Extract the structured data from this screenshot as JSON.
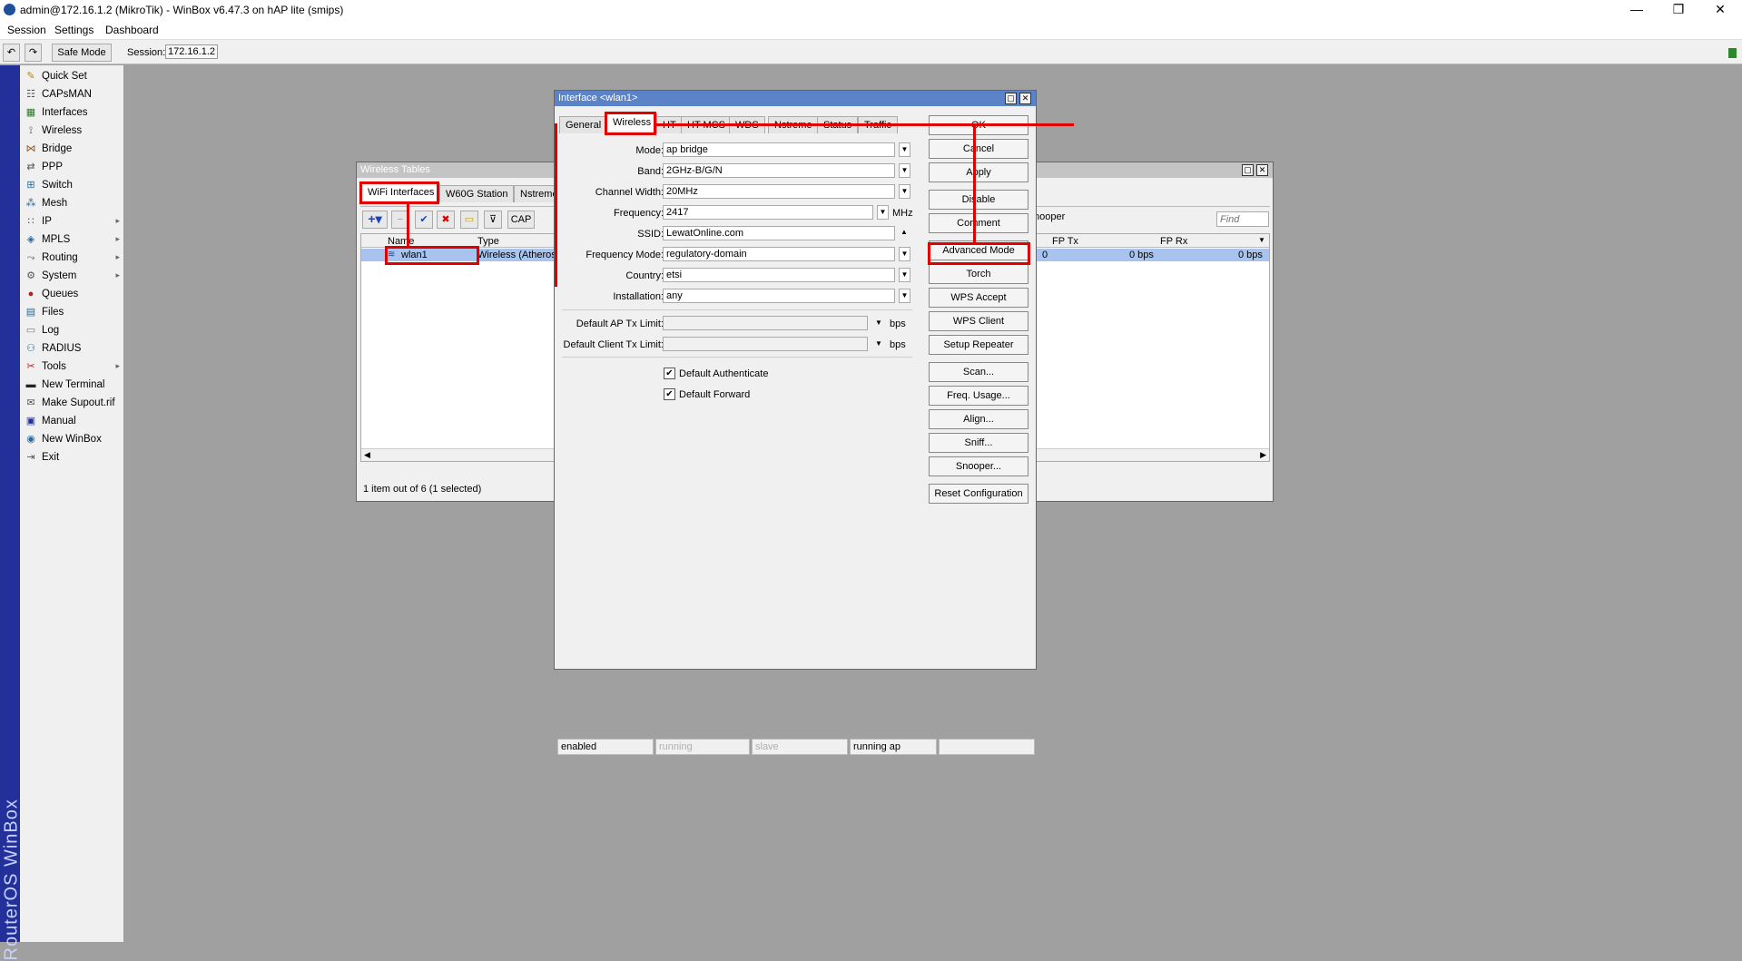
{
  "window": {
    "title": "admin@172.16.1.2 (MikroTik) - WinBox v6.47.3 on hAP lite (smips)",
    "minimize": "—",
    "restore": "❐",
    "close": "✕"
  },
  "menu": [
    "Session",
    "Settings",
    "Dashboard"
  ],
  "toolbar": {
    "undo": "↶",
    "redo": "↷",
    "safe_mode": "Safe Mode",
    "session_label": "Session:",
    "session_value": "172.16.1.2"
  },
  "brand": "RouterOS WinBox",
  "sidebar": {
    "items": [
      {
        "label": "Quick Set",
        "icon": "quick-set-icon",
        "glyph": "✎",
        "arrow": ""
      },
      {
        "label": "CAPsMAN",
        "icon": "capsman-icon",
        "glyph": "☷",
        "arrow": ""
      },
      {
        "label": "Interfaces",
        "icon": "interfaces-icon",
        "glyph": "▦",
        "arrow": ""
      },
      {
        "label": "Wireless",
        "icon": "wireless-icon",
        "glyph": "⟟",
        "arrow": ""
      },
      {
        "label": "Bridge",
        "icon": "bridge-icon",
        "glyph": "⋈",
        "arrow": ""
      },
      {
        "label": "PPP",
        "icon": "ppp-icon",
        "glyph": "⇄",
        "arrow": ""
      },
      {
        "label": "Switch",
        "icon": "switch-icon",
        "glyph": "⊞",
        "arrow": ""
      },
      {
        "label": "Mesh",
        "icon": "mesh-icon",
        "glyph": "⁂",
        "arrow": ""
      },
      {
        "label": "IP",
        "icon": "ip-icon",
        "glyph": "∷",
        "arrow": "▸"
      },
      {
        "label": "MPLS",
        "icon": "mpls-icon",
        "glyph": "◈",
        "arrow": "▸"
      },
      {
        "label": "Routing",
        "icon": "routing-icon",
        "glyph": "⤳",
        "arrow": "▸"
      },
      {
        "label": "System",
        "icon": "system-icon",
        "glyph": "⚙",
        "arrow": "▸"
      },
      {
        "label": "Queues",
        "icon": "queues-icon",
        "glyph": "●",
        "arrow": ""
      },
      {
        "label": "Files",
        "icon": "files-icon",
        "glyph": "▤",
        "arrow": ""
      },
      {
        "label": "Log",
        "icon": "log-icon",
        "glyph": "▭",
        "arrow": ""
      },
      {
        "label": "RADIUS",
        "icon": "radius-icon",
        "glyph": "⚇",
        "arrow": ""
      },
      {
        "label": "Tools",
        "icon": "tools-icon",
        "glyph": "✂",
        "arrow": "▸"
      },
      {
        "label": "New Terminal",
        "icon": "terminal-icon",
        "glyph": "▬",
        "arrow": ""
      },
      {
        "label": "Make Supout.rif",
        "icon": "supout-icon",
        "glyph": "✉",
        "arrow": ""
      },
      {
        "label": "Manual",
        "icon": "manual-icon",
        "glyph": "▣",
        "arrow": ""
      },
      {
        "label": "New WinBox",
        "icon": "winbox-icon",
        "glyph": "◉",
        "arrow": ""
      },
      {
        "label": "Exit",
        "icon": "exit-icon",
        "glyph": "⇥",
        "arrow": ""
      }
    ]
  },
  "wireless_tables": {
    "title": "Wireless Tables",
    "tabs": [
      "WiFi Interfaces",
      "W60G Station",
      "Nstreme"
    ],
    "cap_label": "CAP",
    "snooper_label": "nooper",
    "find_placeholder": "Find",
    "columns": {
      "name": "Name",
      "type": "Type",
      "fp_tx": "FP Tx",
      "fp_rx": "FP Rx"
    },
    "row": {
      "name": "wlan1",
      "type": "Wireless (Atheros",
      "fp_tx": "0 bps",
      "fp_rx": "0 bps",
      "tx_pre": "0"
    },
    "status": "1 item out of 6 (1 selected)"
  },
  "interface_dialog": {
    "title": "Interface <wlan1>",
    "tabs": [
      "General",
      "Wireless",
      "HT",
      "HT MCS",
      "WDS",
      "Nstreme",
      "Status",
      "Traffic"
    ],
    "fields": {
      "mode": {
        "label": "Mode:",
        "value": "ap bridge"
      },
      "band": {
        "label": "Band:",
        "value": "2GHz-B/G/N"
      },
      "channel_width": {
        "label": "Channel Width:",
        "value": "20MHz"
      },
      "frequency": {
        "label": "Frequency:",
        "value": "2417",
        "unit": "MHz"
      },
      "ssid": {
        "label": "SSID:",
        "value": "LewatOnline.com"
      },
      "frequency_mode": {
        "label": "Frequency Mode:",
        "value": "regulatory-domain"
      },
      "country": {
        "label": "Country:",
        "value": "etsi"
      },
      "installation": {
        "label": "Installation:",
        "value": "any"
      },
      "ap_tx_limit": {
        "label": "Default AP Tx Limit:",
        "value": "",
        "unit": "bps"
      },
      "client_tx_limit": {
        "label": "Default Client Tx Limit:",
        "value": "",
        "unit": "bps"
      }
    },
    "checkboxes": {
      "default_authenticate": {
        "label": "Default Authenticate",
        "checked": "✔"
      },
      "default_forward": {
        "label": "Default Forward",
        "checked": "✔"
      }
    },
    "buttons": [
      "OK",
      "Cancel",
      "Apply",
      "Disable",
      "Comment",
      "Advanced Mode",
      "Torch",
      "WPS Accept",
      "WPS Client",
      "Setup Repeater",
      "Scan...",
      "Freq. Usage...",
      "Align...",
      "Sniff...",
      "Snooper...",
      "Reset Configuration"
    ],
    "status": [
      "enabled",
      "running",
      "slave",
      "running ap"
    ]
  },
  "colors": {
    "highlight": "#e00000",
    "title_active": "#5a83c8",
    "selected_row": "#a8c4ee",
    "brand_bar": "#24309a"
  }
}
